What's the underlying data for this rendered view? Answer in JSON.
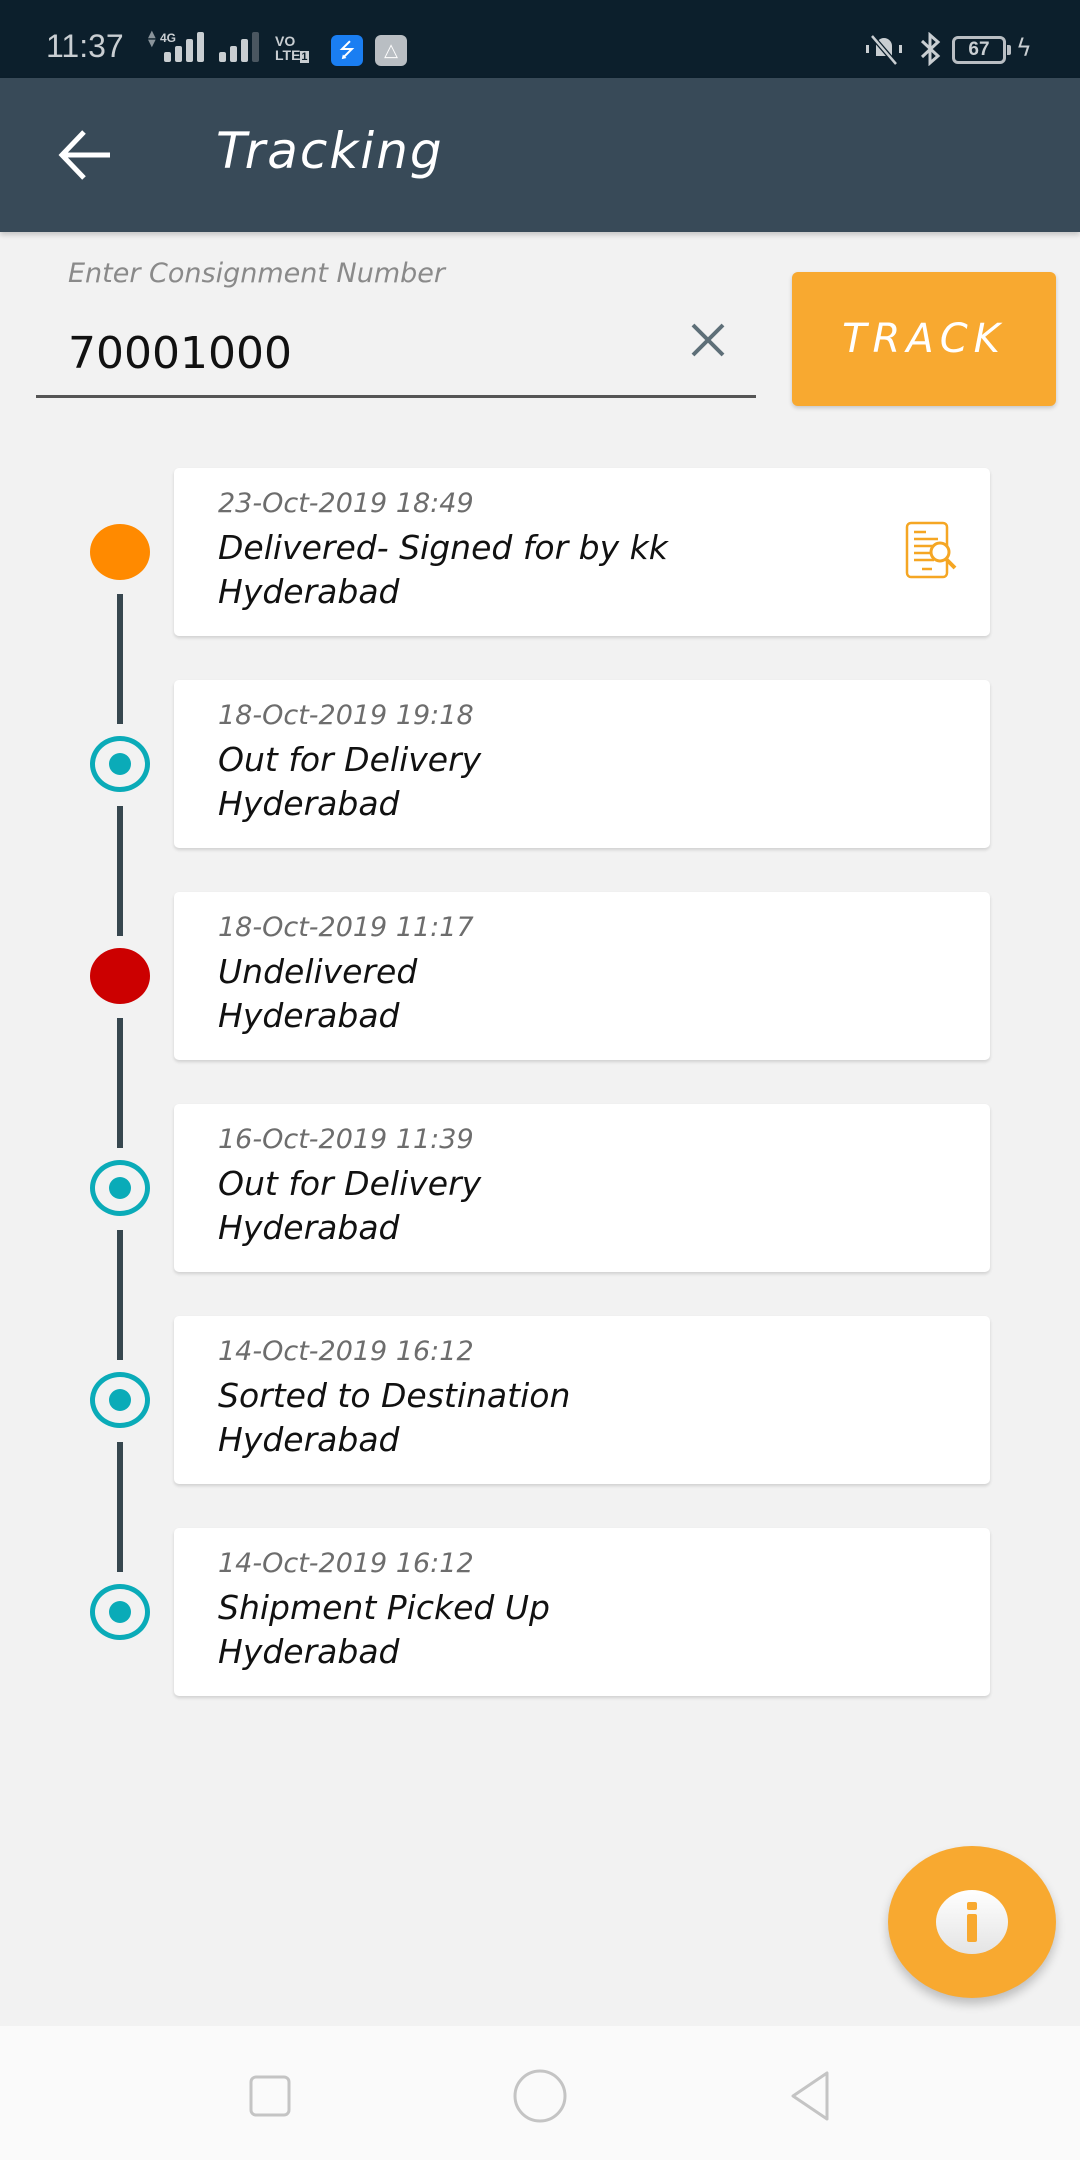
{
  "status_bar": {
    "time": "11:37",
    "network": "4G",
    "volte": "VO\nLTE1",
    "battery": "67",
    "icons": [
      "data-arrows-icon",
      "signal-icon",
      "signal-icon",
      "volte-icon",
      "usb-icon",
      "share-icon",
      "vibrate-mute-icon",
      "bluetooth-icon",
      "battery-icon",
      "charging-icon"
    ]
  },
  "app_bar": {
    "title": "Tracking",
    "back_icon": "arrow-left-icon"
  },
  "search": {
    "label": "Enter Consignment Number",
    "value": "70001000",
    "clear_icon": "close-icon",
    "track_label": "TRACK"
  },
  "colors": {
    "app_bar": "#384a58",
    "accent": "#f8a930",
    "delivered": "#ff8a00",
    "undelivered": "#cc0000",
    "in_transit": "#0aabb8",
    "timeline_line": "#37474f"
  },
  "timeline": [
    {
      "date": "23-Oct-2019 18:49",
      "status": "Delivered- Signed for by kk",
      "location": "Hyderabad",
      "marker": "filled-orange",
      "has_pod_icon": true
    },
    {
      "date": "18-Oct-2019 19:18",
      "status": "Out for Delivery",
      "location": "Hyderabad",
      "marker": "ring-teal",
      "has_pod_icon": false
    },
    {
      "date": "18-Oct-2019 11:17",
      "status": "Undelivered",
      "location": "Hyderabad",
      "marker": "filled-red",
      "has_pod_icon": false
    },
    {
      "date": "16-Oct-2019 11:39",
      "status": "Out for Delivery",
      "location": "Hyderabad",
      "marker": "ring-teal",
      "has_pod_icon": false
    },
    {
      "date": "14-Oct-2019 16:12",
      "status": "Sorted to Destination",
      "location": "Hyderabad",
      "marker": "ring-teal",
      "has_pod_icon": false
    },
    {
      "date": "14-Oct-2019 16:12",
      "status": "Shipment Picked Up",
      "location": "Hyderabad",
      "marker": "ring-teal",
      "has_pod_icon": false
    }
  ],
  "fab": {
    "icon": "info-icon"
  },
  "nav_bar": {
    "buttons": [
      "recents-icon",
      "home-icon",
      "back-icon"
    ]
  }
}
